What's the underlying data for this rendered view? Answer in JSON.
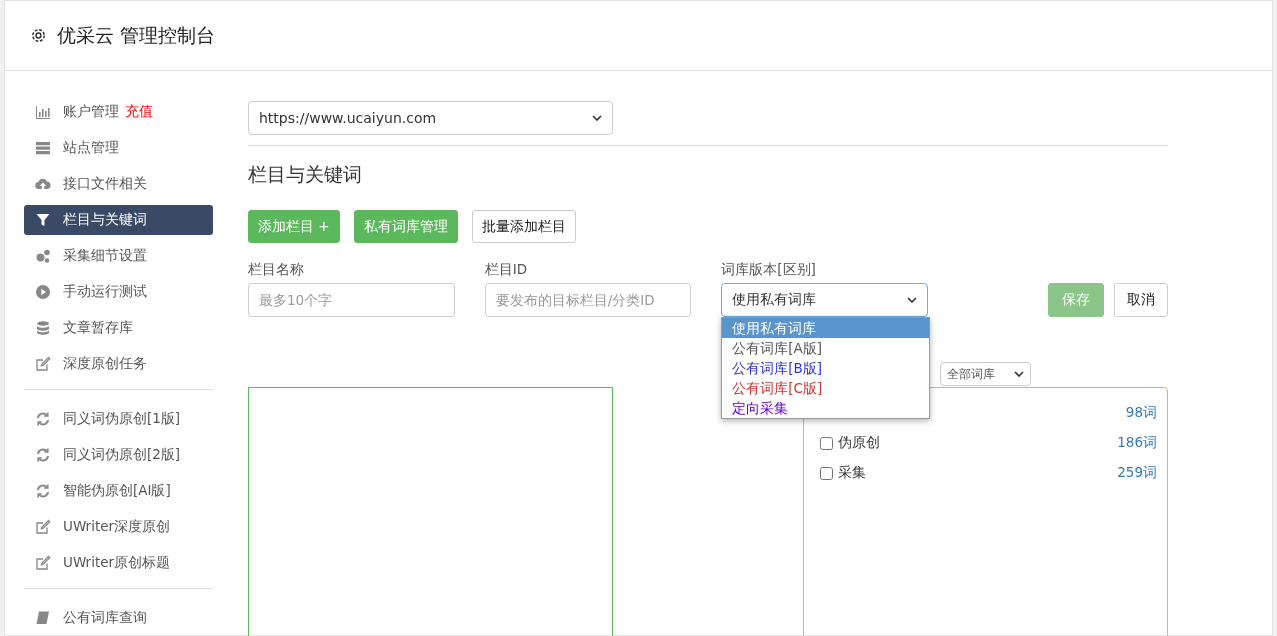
{
  "header": {
    "title": "优采云 管理控制台"
  },
  "sidebar": {
    "groups": [
      [
        {
          "label": "账户管理",
          "badge": "充值",
          "selected": false
        },
        {
          "label": "站点管理",
          "selected": false
        },
        {
          "label": "接口文件相关",
          "selected": false
        },
        {
          "label": "栏目与关键词",
          "selected": true
        },
        {
          "label": "采集细节设置",
          "selected": false
        },
        {
          "label": "手动运行测试",
          "selected": false
        },
        {
          "label": "文章暂存库",
          "selected": false
        },
        {
          "label": "深度原创任务",
          "selected": false
        }
      ],
      [
        {
          "label": "同义词伪原创[1版]",
          "selected": false
        },
        {
          "label": "同义词伪原创[2版]",
          "selected": false
        },
        {
          "label": "智能伪原创[AI版]",
          "selected": false
        },
        {
          "label": "UWriter深度原创",
          "selected": false
        },
        {
          "label": "UWriter原创标题",
          "selected": false
        }
      ],
      [
        {
          "label": "公有词库查询",
          "selected": false
        }
      ]
    ]
  },
  "site_select": {
    "value": "https://www.ucaiyun.com"
  },
  "section_title": "栏目与关键词",
  "buttons": [
    {
      "label": "添加栏目 +",
      "kind": "primary"
    },
    {
      "label": "私有词库管理",
      "kind": "primary"
    },
    {
      "label": "批量添加栏目",
      "kind": "default"
    }
  ],
  "form": {
    "name": {
      "label": "栏目名称",
      "placeholder": "最多10个字"
    },
    "id": {
      "label": "栏目ID",
      "placeholder": "要发布的目标栏目/分类ID"
    },
    "version": {
      "label": "词库版本[区别]",
      "value": "使用私有词库",
      "expanded": true,
      "options": [
        {
          "label": "使用私有词库",
          "selected": true,
          "color": "#ffffff"
        },
        {
          "label": "公有词库[A版]",
          "selected": false,
          "color": "#555555"
        },
        {
          "label": "公有词库[B版]",
          "selected": false,
          "color": "#3333cc"
        },
        {
          "label": "公有词库[C版]",
          "selected": false,
          "color": "#cc3333"
        },
        {
          "label": "定向采集",
          "selected": false,
          "color": "#6600cc"
        }
      ]
    },
    "save": "保存",
    "cancel": "取消"
  },
  "filter_select": {
    "value": "全部词库"
  },
  "library_list": [
    {
      "count": "98词"
    },
    {
      "name": "伪原创",
      "count": "186词",
      "checked": false
    },
    {
      "name": "采集",
      "count": "259词",
      "checked": false
    }
  ]
}
